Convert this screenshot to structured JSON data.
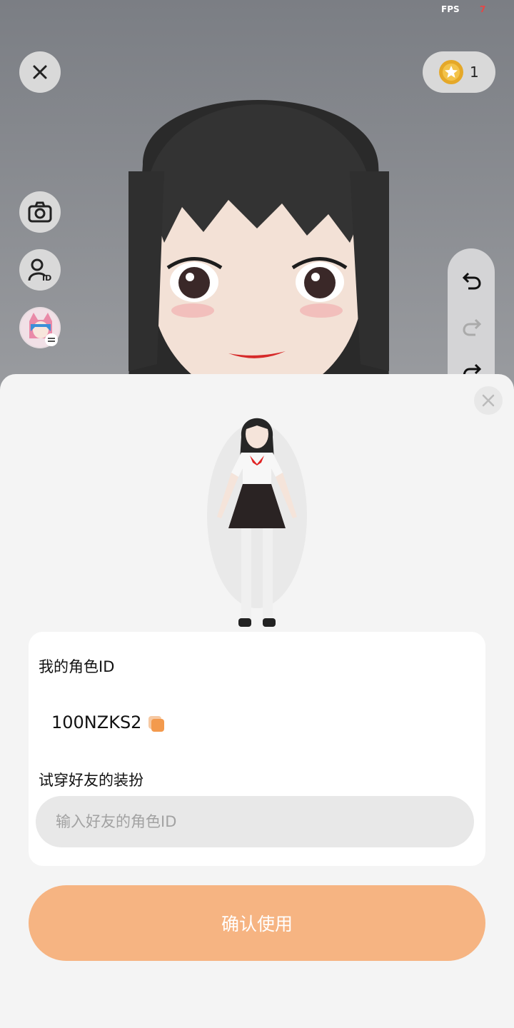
{
  "status": {
    "fps_label": "FPS",
    "fps_value": "7"
  },
  "top_bar": {
    "coin_count": "1"
  },
  "sheet": {
    "my_id_label": "我的角色ID",
    "my_id_value": "100NZKS2",
    "try_on_label": "试穿好友的装扮",
    "friend_id_placeholder": "输入好友的角色ID",
    "confirm_label": "确认使用"
  },
  "colors": {
    "accent": "#f6b482",
    "sheet_bg": "#f4f4f4",
    "input_bg": "#e8e8e8",
    "copy_icon": "#f39a4d"
  },
  "icons": [
    "close-icon",
    "coin-icon",
    "camera-icon",
    "profile-id-icon",
    "avatar-switch-icon",
    "undo-icon",
    "redo-icon",
    "rotate-icon",
    "copy-icon"
  ]
}
